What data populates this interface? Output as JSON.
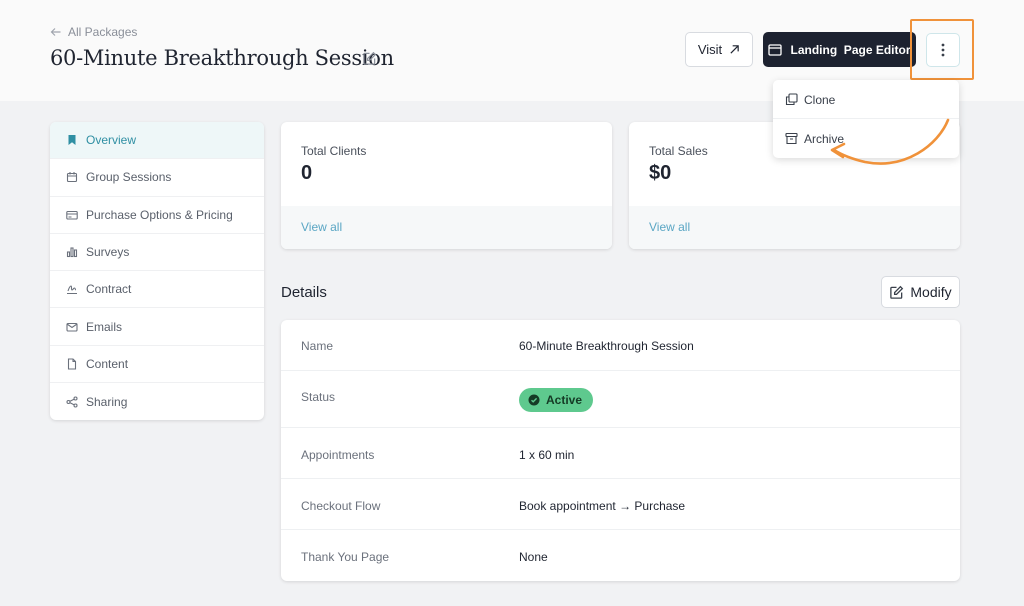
{
  "header": {
    "back_label": "All Packages",
    "title": "60-Minute Breakthrough Session",
    "visit_label": "Visit",
    "editor_label": "Landing  Page Editor"
  },
  "menu": {
    "items": [
      {
        "label": "Clone",
        "icon": "clone-icon"
      },
      {
        "label": "Archive",
        "icon": "archive-icon"
      }
    ]
  },
  "sidebar": {
    "items": [
      {
        "label": "Overview",
        "icon": "bookmark-icon",
        "active": true
      },
      {
        "label": "Group Sessions",
        "icon": "calendar-icon"
      },
      {
        "label": "Purchase Options & Pricing",
        "icon": "credit-card-icon"
      },
      {
        "label": "Surveys",
        "icon": "bar-chart-icon"
      },
      {
        "label": "Contract",
        "icon": "signature-icon"
      },
      {
        "label": "Emails",
        "icon": "mail-icon"
      },
      {
        "label": "Content",
        "icon": "document-icon"
      },
      {
        "label": "Sharing",
        "icon": "share-icon"
      }
    ]
  },
  "stats": [
    {
      "label": "Total Clients",
      "value": "0",
      "link": "View all"
    },
    {
      "label": "Total Sales",
      "value": "$0",
      "link": "View all"
    }
  ],
  "details": {
    "title": "Details",
    "modify_label": "Modify",
    "rows": [
      {
        "label": "Name",
        "value": "60-Minute Breakthrough Session"
      },
      {
        "label": "Status",
        "value": "Active"
      },
      {
        "label": "Appointments",
        "value": "1 x 60 min"
      },
      {
        "label": "Checkout Flow",
        "value": "Book appointment → Purchase"
      },
      {
        "label": "Thank You Page",
        "value": "None"
      }
    ]
  },
  "colors": {
    "accent": "#2f8fa3",
    "primary_button": "#1d2230",
    "status_active": "#5ec98e",
    "highlight": "#f0923a"
  }
}
